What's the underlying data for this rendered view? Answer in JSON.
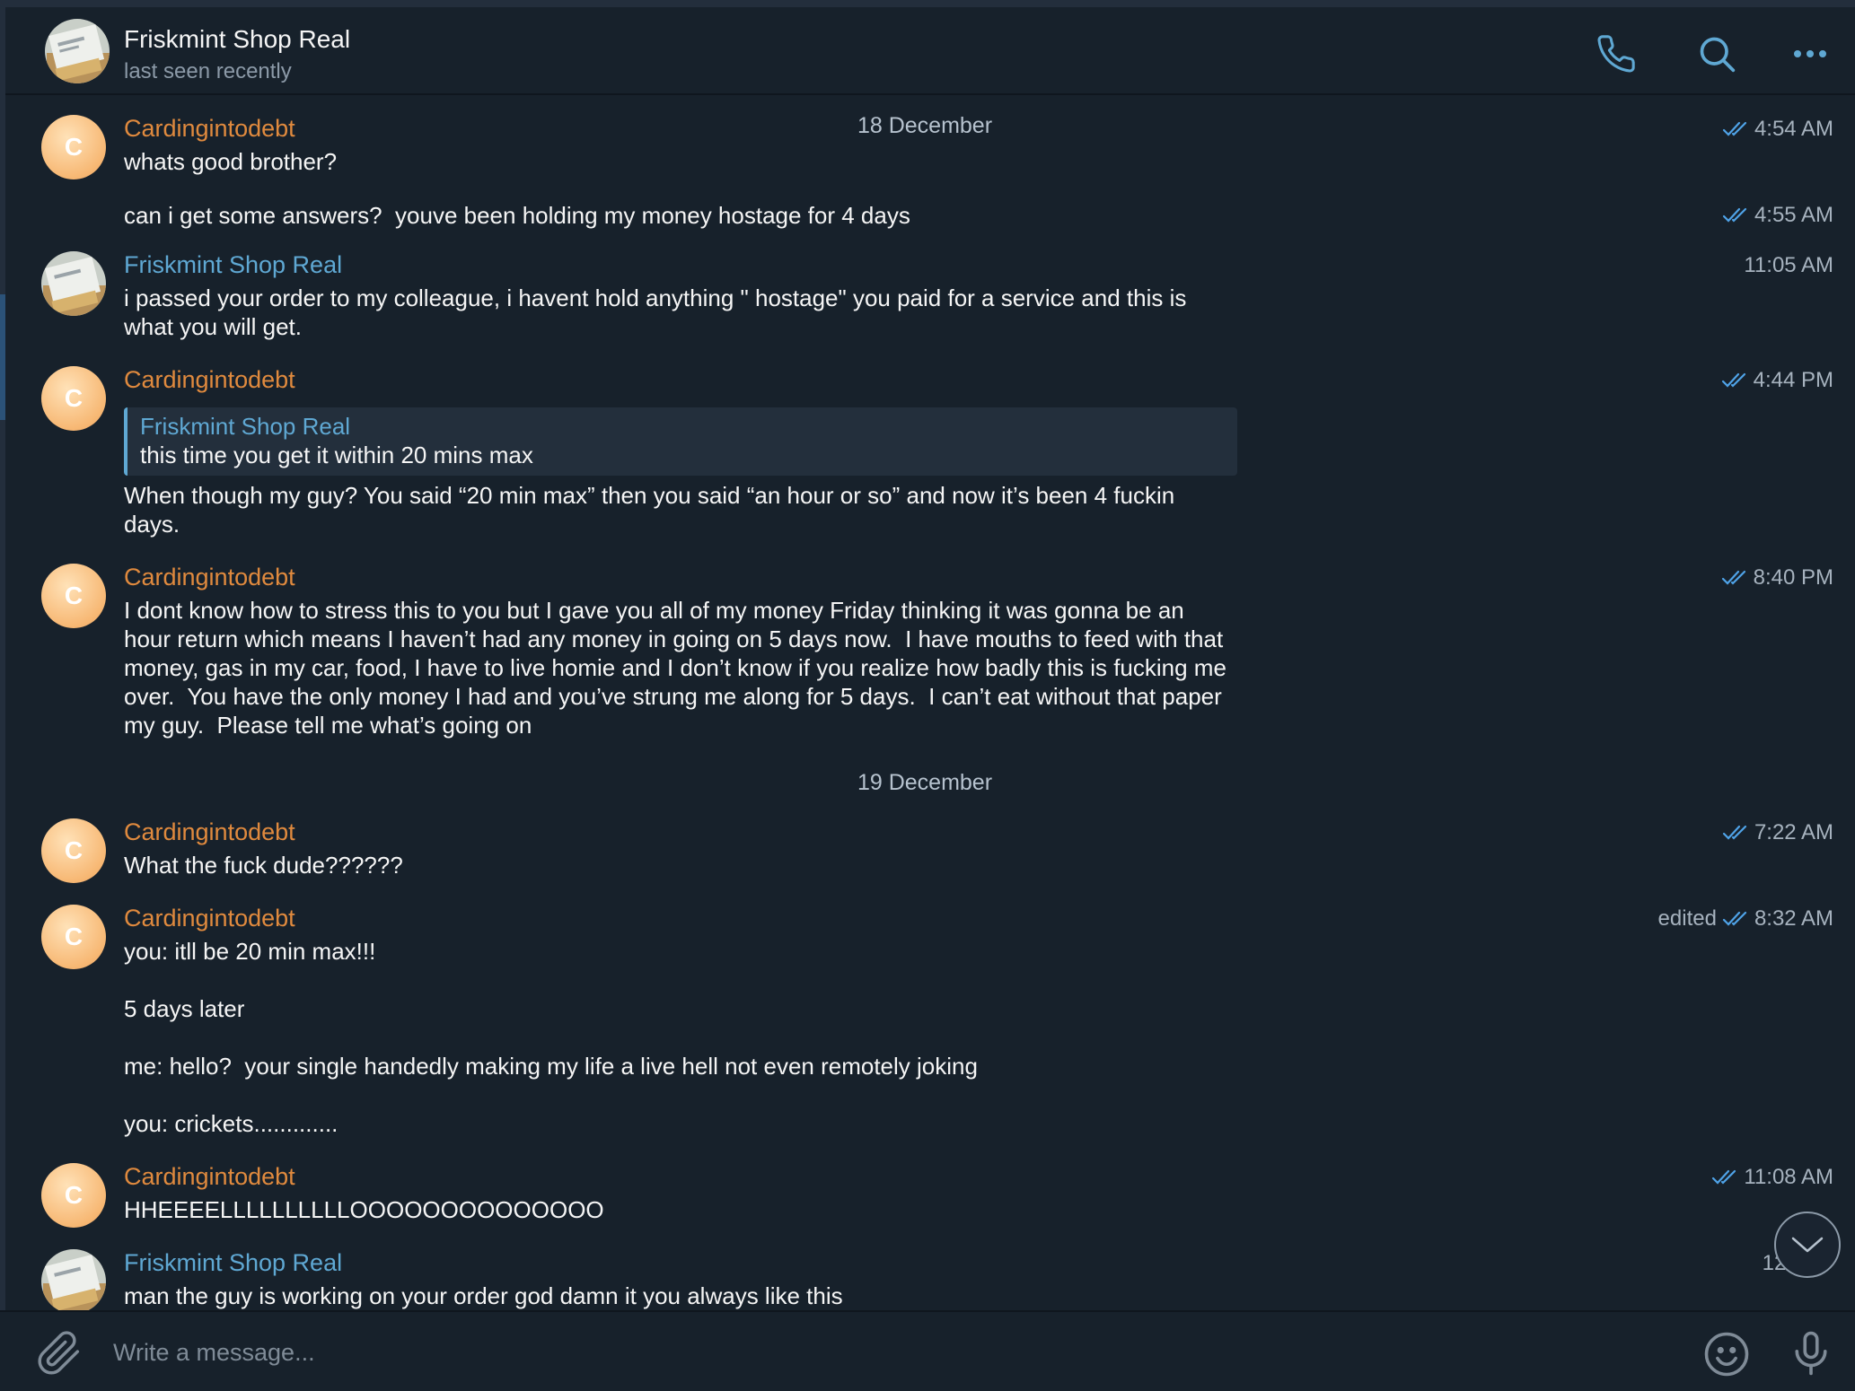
{
  "header": {
    "title": "Friskmint Shop Real",
    "status": "last seen recently",
    "icons": [
      "phone-icon",
      "search-icon",
      "more-icon"
    ]
  },
  "dates": [
    "18 December",
    "19 December"
  ],
  "messages": [
    {
      "sender": "Cardingintodebt",
      "text": "whats good brother?",
      "time": "4:54 AM",
      "read": true
    },
    {
      "text": "can i get some answers?  youve been holding my money hostage for 4 days",
      "time": "4:55 AM",
      "read": true
    },
    {
      "sender": "Friskmint Shop Real",
      "text": "i passed your order to my colleague, i havent hold anything \" hostage\" you paid for a service and this is\nwhat you will get.",
      "time": "11:05 AM"
    },
    {
      "sender": "Cardingintodebt",
      "reply": {
        "name": "Friskmint Shop Real",
        "text": "this time you get it within 20 mins max"
      },
      "text": "When though my guy? You said “20 min max” then you said “an hour or so” and now it’s been 4 fuckin\ndays.",
      "time": "4:44 PM",
      "read": true
    },
    {
      "sender": "Cardingintodebt",
      "text": "I dont know how to stress this to you but I gave you all of my money Friday thinking it was gonna be an\nhour return which means I haven’t had any money in going on 5 days now.  I have mouths to feed with that\nmoney, gas in my car, food, I have to live homie and I don’t know if you realize how badly this is fucking me\nover.  You have the only money I had and you’ve strung me along for 5 days.  I can’t eat without that paper\nmy guy.  Please tell me what’s going on",
      "time": "8:40 PM",
      "read": true
    },
    {
      "sender": "Cardingintodebt",
      "text": "What the fuck dude??????",
      "time": "7:22 AM",
      "read": true
    },
    {
      "sender": "Cardingintodebt",
      "text": "you: itll be 20 min max!!!\n\n5 days later\n\nme: hello?  your single handedly making my life a live hell not even remotely joking\n\nyou: crickets.............",
      "time": "8:32 AM",
      "edited": "edited",
      "read": true
    },
    {
      "sender": "Cardingintodebt",
      "text": "HHEEEELLLLLLLLLLOOOOOOOOOOOOOO",
      "time": "11:08 AM",
      "read": true
    },
    {
      "sender": "Friskmint Shop Real",
      "text": "man the guy is working on your order god damn it you always like this",
      "time": "12:"
    }
  ],
  "avatar_initial": "C",
  "input": {
    "placeholder": "Write a message..."
  },
  "colors": {
    "background": "#17212b",
    "sender_orange": "#e08a3e",
    "sender_blue": "#5fa8d3",
    "check_blue": "#4fa3e8"
  }
}
